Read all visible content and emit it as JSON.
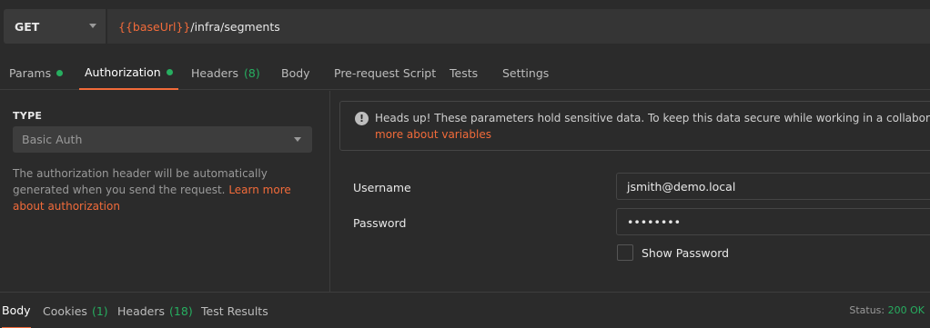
{
  "request": {
    "method": "GET",
    "url_variable": "{{baseUrl}}",
    "url_path": "/infra/segments"
  },
  "tabs": [
    {
      "label": "Params",
      "dot": true
    },
    {
      "label": "Authorization",
      "dot": true,
      "active": true
    },
    {
      "label": "Headers",
      "count": "(8)"
    },
    {
      "label": "Body"
    },
    {
      "label": "Pre-request Script"
    },
    {
      "label": "Tests"
    },
    {
      "label": "Settings"
    }
  ],
  "auth": {
    "type_label": "TYPE",
    "type_value": "Basic Auth",
    "description": "The authorization header will be automatically generated when you send the request.",
    "learn_link": "Learn more about authorization"
  },
  "notice": {
    "text": "Heads up! These parameters hold sensitive data. To keep this data secure while working in a collaborative envir",
    "link": "more about variables"
  },
  "fields": {
    "username_label": "Username",
    "username_value": "jsmith@demo.local",
    "password_label": "Password",
    "password_value": "••••••••",
    "show_password_label": "Show Password"
  },
  "response": {
    "tabs": [
      {
        "label": "Body",
        "active": true
      },
      {
        "label": "Cookies",
        "count": "(1)"
      },
      {
        "label": "Headers",
        "count": "(18)"
      },
      {
        "label": "Test Results"
      }
    ],
    "status_label": "Status:",
    "status_value": "200 OK"
  },
  "colors": {
    "accent": "#f26b3a",
    "success": "#27ae60",
    "background": "#2b2b2b"
  }
}
